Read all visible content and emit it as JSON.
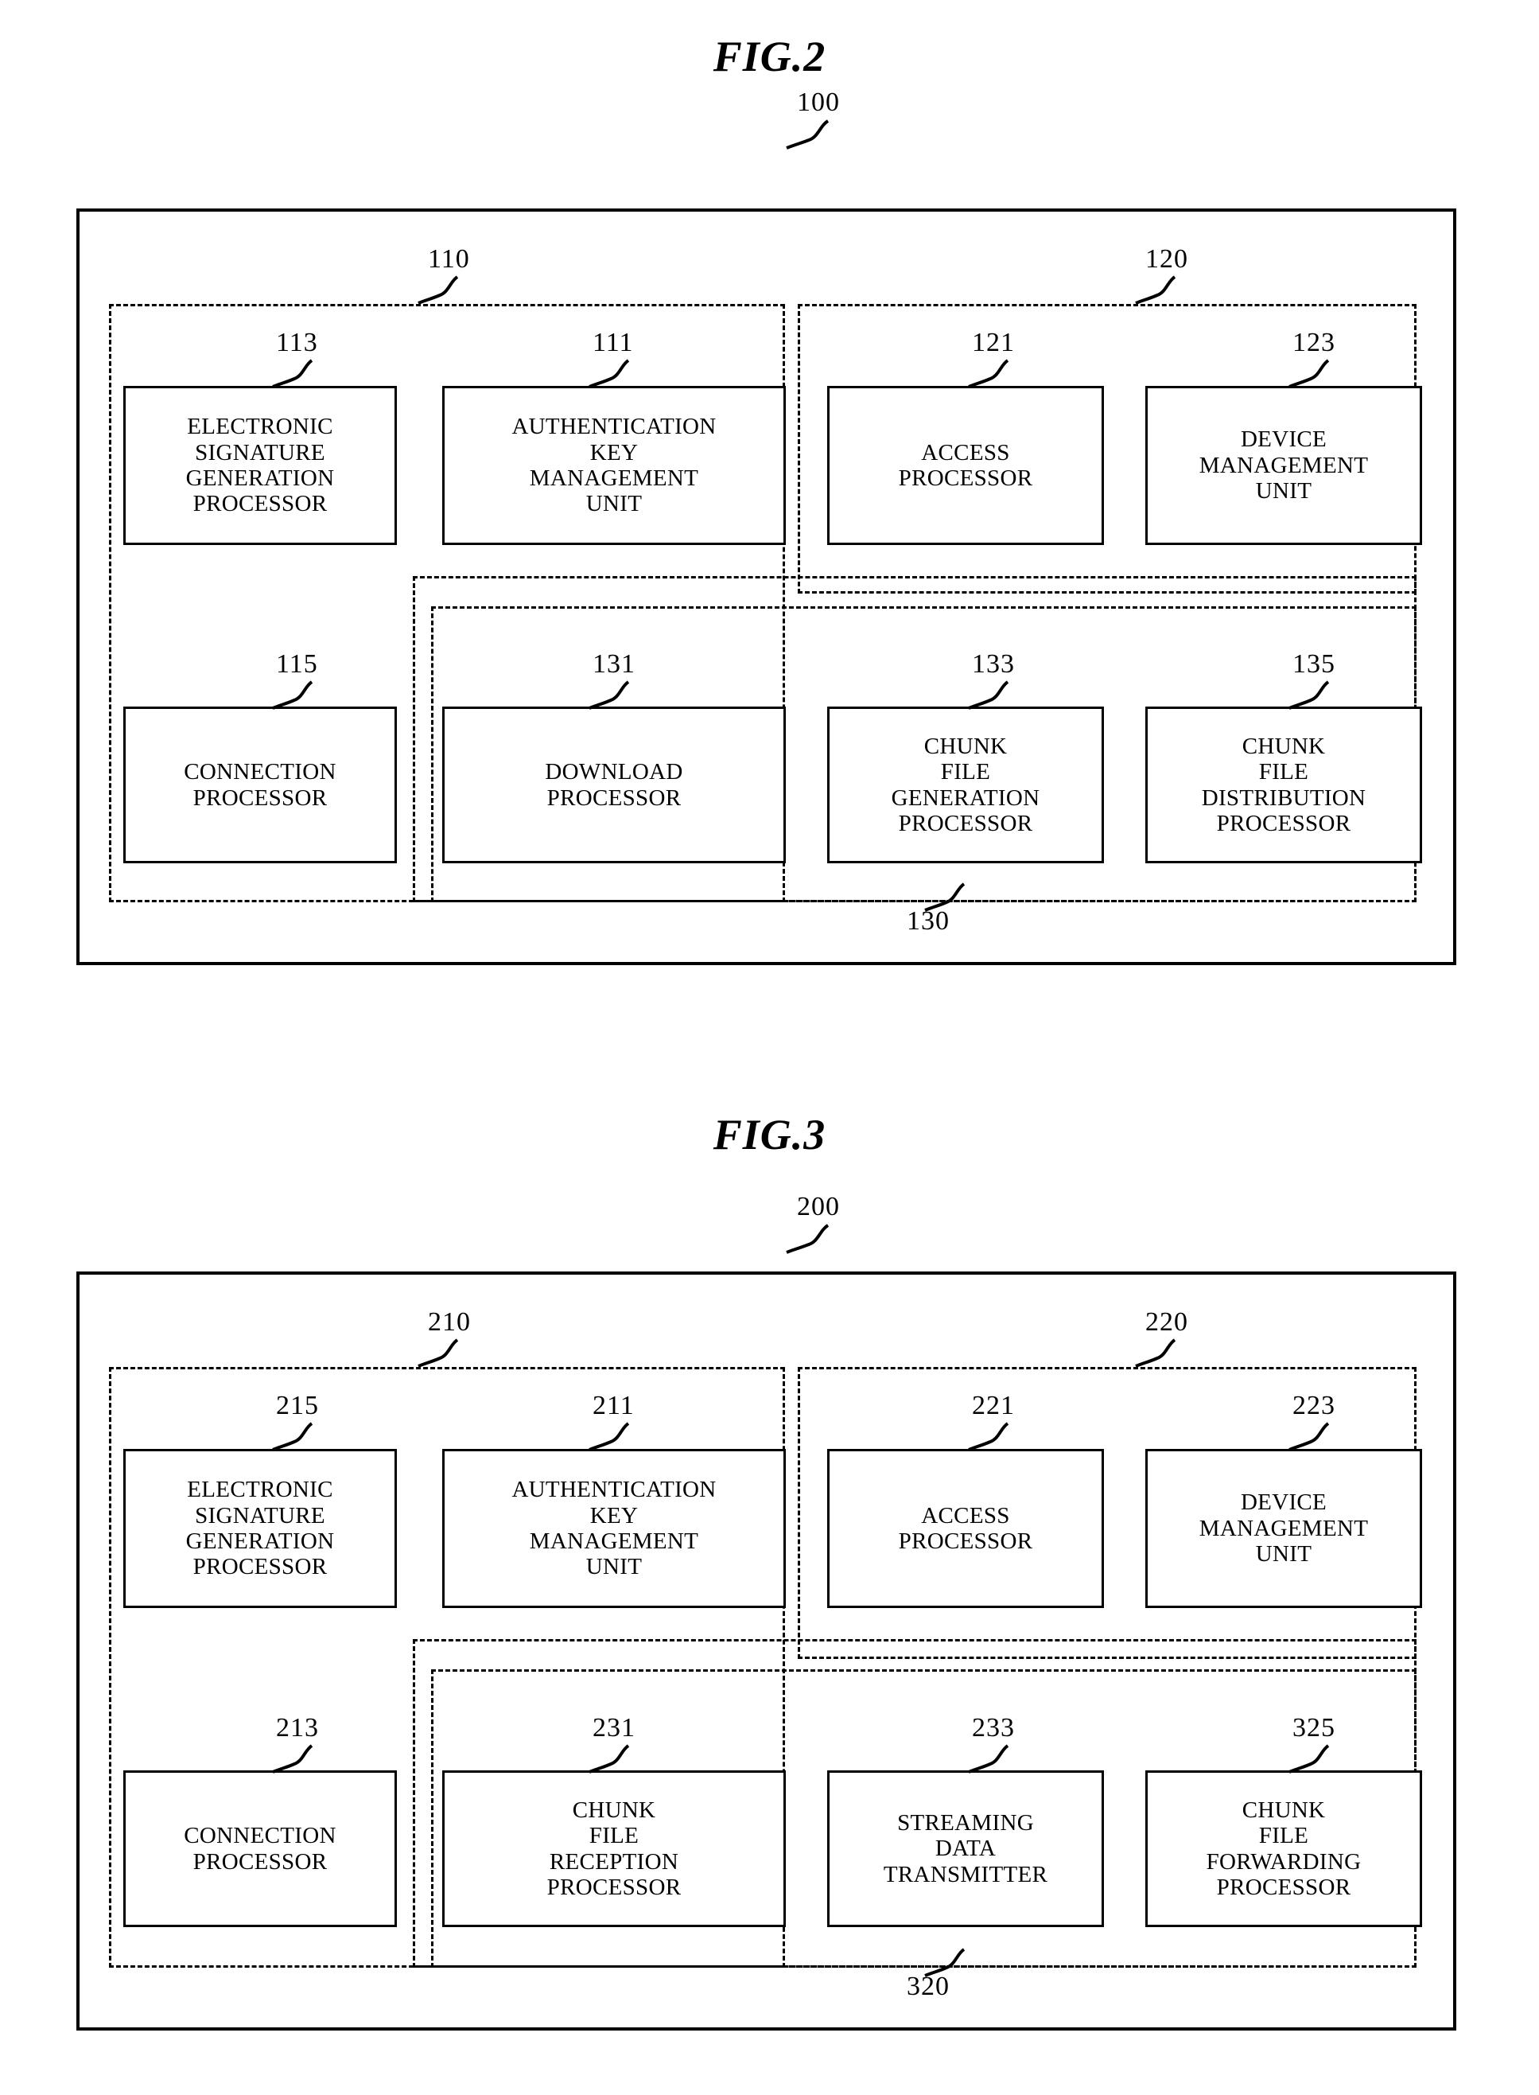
{
  "figures": [
    {
      "title": "FIG.2",
      "outer_ref": "100",
      "groups": [
        {
          "ref": "110"
        },
        {
          "ref": "120"
        },
        {
          "ref": "130"
        }
      ],
      "modules": [
        {
          "ref": "113",
          "label": "ELECTRONIC\nSIGNATURE\nGENERATION\nPROCESSOR"
        },
        {
          "ref": "111",
          "label": "AUTHENTICATION\nKEY\nMANAGEMENT\nUNIT"
        },
        {
          "ref": "121",
          "label": "ACCESS\nPROCESSOR"
        },
        {
          "ref": "123",
          "label": "DEVICE\nMANAGEMENT\nUNIT"
        },
        {
          "ref": "115",
          "label": "CONNECTION\nPROCESSOR"
        },
        {
          "ref": "131",
          "label": "DOWNLOAD\nPROCESSOR"
        },
        {
          "ref": "133",
          "label": "CHUNK\nFILE\nGENERATION\nPROCESSOR"
        },
        {
          "ref": "135",
          "label": "CHUNK\nFILE\nDISTRIBUTION\nPROCESSOR"
        }
      ]
    },
    {
      "title": "FIG.3",
      "outer_ref": "200",
      "groups": [
        {
          "ref": "210"
        },
        {
          "ref": "220"
        },
        {
          "ref": "320"
        }
      ],
      "modules": [
        {
          "ref": "215",
          "label": "ELECTRONIC\nSIGNATURE\nGENERATION\nPROCESSOR"
        },
        {
          "ref": "211",
          "label": "AUTHENTICATION\nKEY\nMANAGEMENT\nUNIT"
        },
        {
          "ref": "221",
          "label": "ACCESS\nPROCESSOR"
        },
        {
          "ref": "223",
          "label": "DEVICE\nMANAGEMENT\nUNIT"
        },
        {
          "ref": "213",
          "label": "CONNECTION\nPROCESSOR"
        },
        {
          "ref": "231",
          "label": "CHUNK\nFILE\nRECEPTION\nPROCESSOR"
        },
        {
          "ref": "233",
          "label": "STREAMING\nDATA\nTRANSMITTER"
        },
        {
          "ref": "325",
          "label": "CHUNK\nFILE\nFORWARDING\nPROCESSOR"
        }
      ]
    }
  ]
}
